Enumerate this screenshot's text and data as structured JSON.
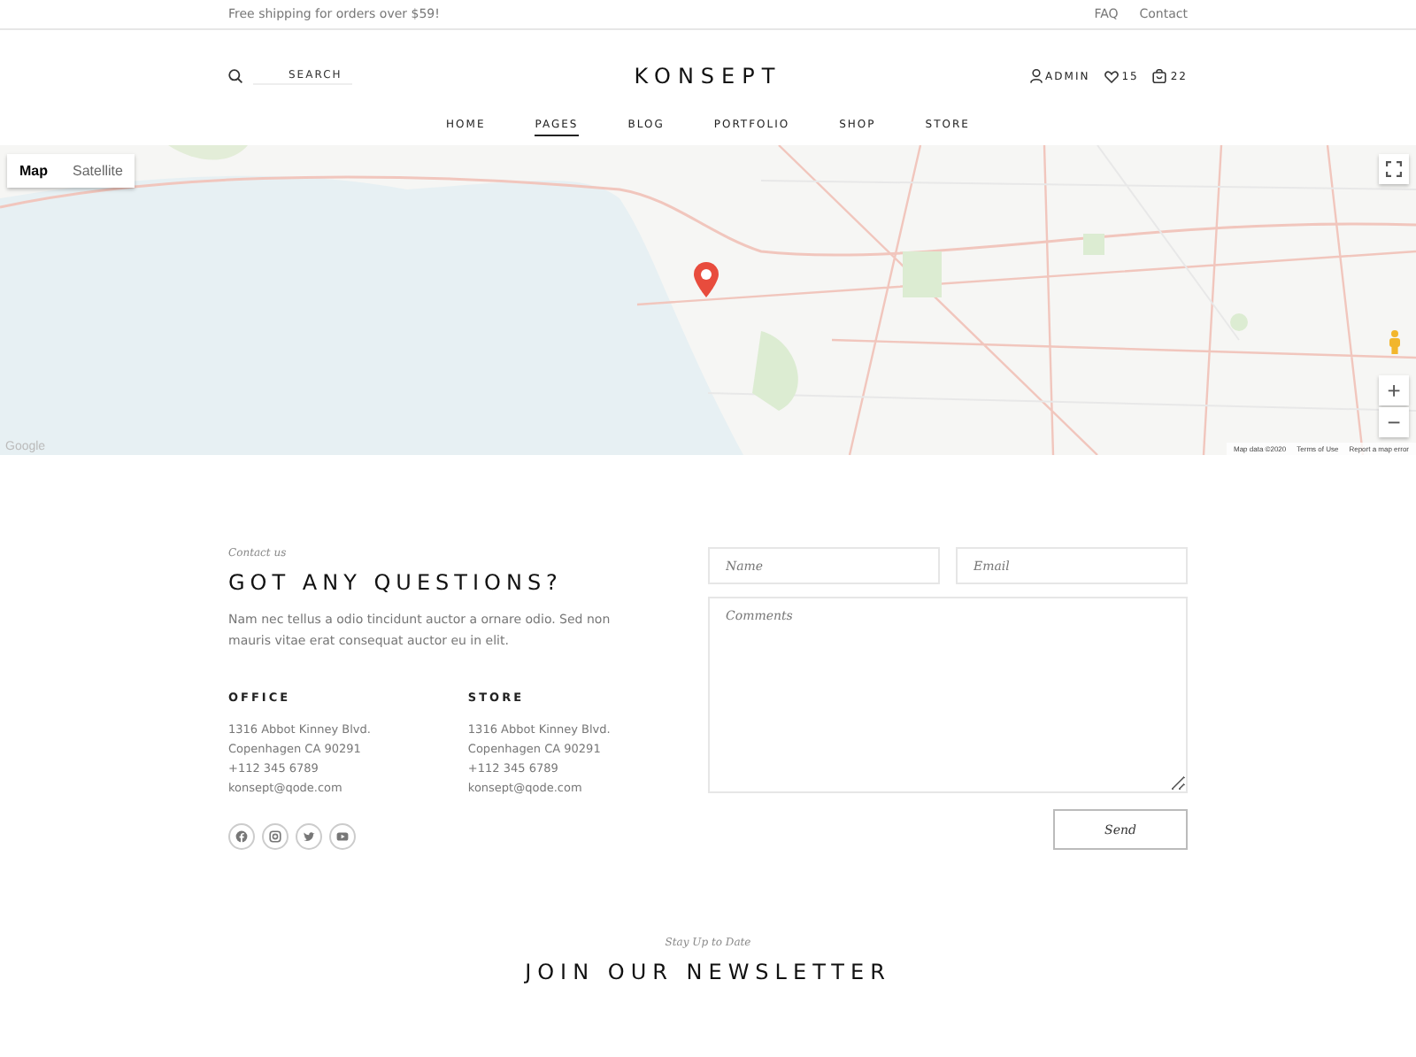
{
  "top_bar": {
    "promo": "Free shipping for orders over $59!",
    "links": [
      "FAQ",
      "Contact"
    ]
  },
  "header": {
    "search_label": "SEARCH",
    "logo": "KONSEPT",
    "account": "ADMIN",
    "wishlist_count": "15",
    "cart_count": "22"
  },
  "nav": [
    {
      "label": "HOME",
      "selected": false
    },
    {
      "label": "PAGES",
      "selected": true
    },
    {
      "label": "BLOG",
      "selected": false
    },
    {
      "label": "PORTFOLIO",
      "selected": false
    },
    {
      "label": "SHOP",
      "selected": false
    },
    {
      "label": "STORE",
      "selected": false
    }
  ],
  "map": {
    "kind": "picture",
    "type_tabs": [
      {
        "label": "Map",
        "selected": true
      },
      {
        "label": "Satellite",
        "selected": false
      }
    ],
    "zoom_in": "+",
    "zoom_out": "−",
    "brand": "Google",
    "footer": [
      "Map data ©2020",
      "Terms of Use",
      "Report a map error"
    ]
  },
  "contact": {
    "eyebrow": "Contact us",
    "title": "GOT ANY QUESTIONS?",
    "text": "Nam nec tellus a odio tincidunt auctor a ornare odio. Sed non mauris vitae erat consequat auctor eu in elit.",
    "locations": [
      {
        "heading": "OFFICE",
        "lines": [
          "1316 Abbot Kinney Blvd.",
          "Copenhagen CA 90291",
          "+112 345 6789",
          "konsept@qode.com"
        ]
      },
      {
        "heading": "STORE",
        "lines": [
          "1316 Abbot Kinney Blvd.",
          "Copenhagen CA 90291",
          "+112 345 6789",
          "konsept@qode.com"
        ]
      }
    ],
    "socials": [
      {
        "kind": "facebook"
      },
      {
        "kind": "instagram"
      },
      {
        "kind": "twitter"
      },
      {
        "kind": "youtube"
      }
    ]
  },
  "form": {
    "name_placeholder": "Name",
    "email_placeholder": "Email",
    "comments_placeholder": "Comments",
    "submit": "Send"
  },
  "newsletter": {
    "eyebrow": "Stay Up to Date",
    "title": "JOIN OUR NEWSLETTER"
  }
}
